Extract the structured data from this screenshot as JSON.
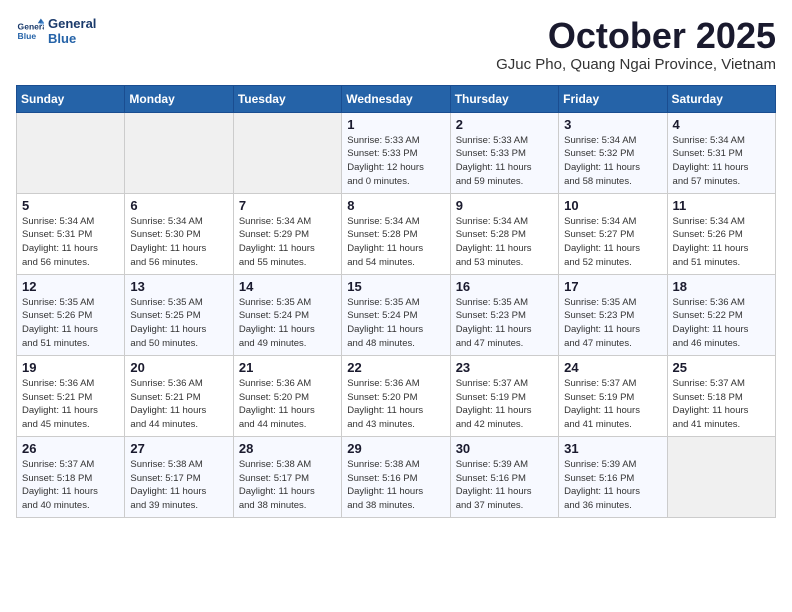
{
  "logo": {
    "line1": "General",
    "line2": "Blue"
  },
  "title": "October 2025",
  "subtitle": "GJuc Pho, Quang Ngai Province, Vietnam",
  "days_of_week": [
    "Sunday",
    "Monday",
    "Tuesday",
    "Wednesday",
    "Thursday",
    "Friday",
    "Saturday"
  ],
  "weeks": [
    [
      {
        "num": "",
        "info": ""
      },
      {
        "num": "",
        "info": ""
      },
      {
        "num": "",
        "info": ""
      },
      {
        "num": "1",
        "info": "Sunrise: 5:33 AM\nSunset: 5:33 PM\nDaylight: 12 hours\nand 0 minutes."
      },
      {
        "num": "2",
        "info": "Sunrise: 5:33 AM\nSunset: 5:33 PM\nDaylight: 11 hours\nand 59 minutes."
      },
      {
        "num": "3",
        "info": "Sunrise: 5:34 AM\nSunset: 5:32 PM\nDaylight: 11 hours\nand 58 minutes."
      },
      {
        "num": "4",
        "info": "Sunrise: 5:34 AM\nSunset: 5:31 PM\nDaylight: 11 hours\nand 57 minutes."
      }
    ],
    [
      {
        "num": "5",
        "info": "Sunrise: 5:34 AM\nSunset: 5:31 PM\nDaylight: 11 hours\nand 56 minutes."
      },
      {
        "num": "6",
        "info": "Sunrise: 5:34 AM\nSunset: 5:30 PM\nDaylight: 11 hours\nand 56 minutes."
      },
      {
        "num": "7",
        "info": "Sunrise: 5:34 AM\nSunset: 5:29 PM\nDaylight: 11 hours\nand 55 minutes."
      },
      {
        "num": "8",
        "info": "Sunrise: 5:34 AM\nSunset: 5:28 PM\nDaylight: 11 hours\nand 54 minutes."
      },
      {
        "num": "9",
        "info": "Sunrise: 5:34 AM\nSunset: 5:28 PM\nDaylight: 11 hours\nand 53 minutes."
      },
      {
        "num": "10",
        "info": "Sunrise: 5:34 AM\nSunset: 5:27 PM\nDaylight: 11 hours\nand 52 minutes."
      },
      {
        "num": "11",
        "info": "Sunrise: 5:34 AM\nSunset: 5:26 PM\nDaylight: 11 hours\nand 51 minutes."
      }
    ],
    [
      {
        "num": "12",
        "info": "Sunrise: 5:35 AM\nSunset: 5:26 PM\nDaylight: 11 hours\nand 51 minutes."
      },
      {
        "num": "13",
        "info": "Sunrise: 5:35 AM\nSunset: 5:25 PM\nDaylight: 11 hours\nand 50 minutes."
      },
      {
        "num": "14",
        "info": "Sunrise: 5:35 AM\nSunset: 5:24 PM\nDaylight: 11 hours\nand 49 minutes."
      },
      {
        "num": "15",
        "info": "Sunrise: 5:35 AM\nSunset: 5:24 PM\nDaylight: 11 hours\nand 48 minutes."
      },
      {
        "num": "16",
        "info": "Sunrise: 5:35 AM\nSunset: 5:23 PM\nDaylight: 11 hours\nand 47 minutes."
      },
      {
        "num": "17",
        "info": "Sunrise: 5:35 AM\nSunset: 5:23 PM\nDaylight: 11 hours\nand 47 minutes."
      },
      {
        "num": "18",
        "info": "Sunrise: 5:36 AM\nSunset: 5:22 PM\nDaylight: 11 hours\nand 46 minutes."
      }
    ],
    [
      {
        "num": "19",
        "info": "Sunrise: 5:36 AM\nSunset: 5:21 PM\nDaylight: 11 hours\nand 45 minutes."
      },
      {
        "num": "20",
        "info": "Sunrise: 5:36 AM\nSunset: 5:21 PM\nDaylight: 11 hours\nand 44 minutes."
      },
      {
        "num": "21",
        "info": "Sunrise: 5:36 AM\nSunset: 5:20 PM\nDaylight: 11 hours\nand 44 minutes."
      },
      {
        "num": "22",
        "info": "Sunrise: 5:36 AM\nSunset: 5:20 PM\nDaylight: 11 hours\nand 43 minutes."
      },
      {
        "num": "23",
        "info": "Sunrise: 5:37 AM\nSunset: 5:19 PM\nDaylight: 11 hours\nand 42 minutes."
      },
      {
        "num": "24",
        "info": "Sunrise: 5:37 AM\nSunset: 5:19 PM\nDaylight: 11 hours\nand 41 minutes."
      },
      {
        "num": "25",
        "info": "Sunrise: 5:37 AM\nSunset: 5:18 PM\nDaylight: 11 hours\nand 41 minutes."
      }
    ],
    [
      {
        "num": "26",
        "info": "Sunrise: 5:37 AM\nSunset: 5:18 PM\nDaylight: 11 hours\nand 40 minutes."
      },
      {
        "num": "27",
        "info": "Sunrise: 5:38 AM\nSunset: 5:17 PM\nDaylight: 11 hours\nand 39 minutes."
      },
      {
        "num": "28",
        "info": "Sunrise: 5:38 AM\nSunset: 5:17 PM\nDaylight: 11 hours\nand 38 minutes."
      },
      {
        "num": "29",
        "info": "Sunrise: 5:38 AM\nSunset: 5:16 PM\nDaylight: 11 hours\nand 38 minutes."
      },
      {
        "num": "30",
        "info": "Sunrise: 5:39 AM\nSunset: 5:16 PM\nDaylight: 11 hours\nand 37 minutes."
      },
      {
        "num": "31",
        "info": "Sunrise: 5:39 AM\nSunset: 5:16 PM\nDaylight: 11 hours\nand 36 minutes."
      },
      {
        "num": "",
        "info": ""
      }
    ]
  ]
}
